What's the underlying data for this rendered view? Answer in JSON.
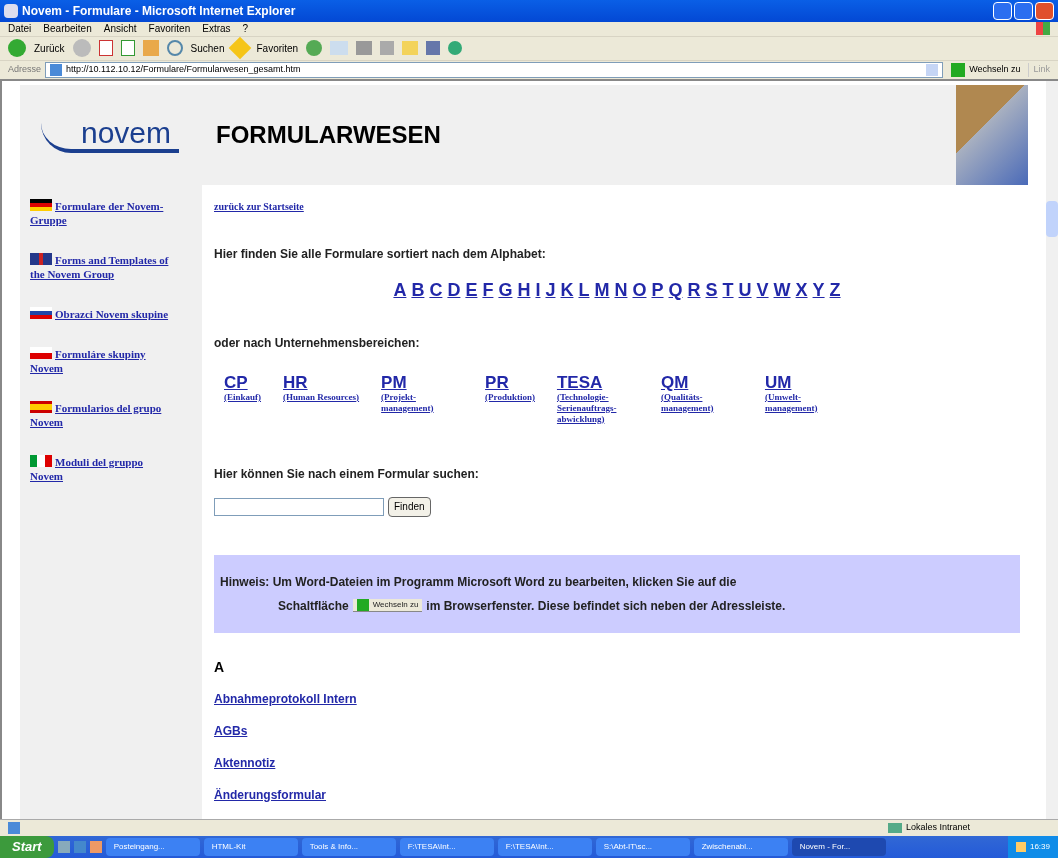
{
  "window": {
    "title": "Novem - Formulare - Microsoft Internet Explorer"
  },
  "menu": [
    "Datei",
    "Bearbeiten",
    "Ansicht",
    "Favoriten",
    "Extras",
    "?"
  ],
  "toolbar": {
    "back": "Zurück",
    "search": "Suchen",
    "favorites": "Favoriten"
  },
  "address": {
    "label": "Adresse",
    "url": "http://10.112.10.12/Formulare/Formularwesen_gesamt.htm",
    "go": "Wechseln zu",
    "links": "Link"
  },
  "page": {
    "logo": "novem",
    "heading": "FORMULARWESEN",
    "sidebar": [
      {
        "kind": "de",
        "label": "Formulare der Novem-Gruppe"
      },
      {
        "kind": "gb",
        "label": "Forms and Templates of the Novem Group"
      },
      {
        "kind": "si",
        "label": "Obrazci Novem skupine"
      },
      {
        "kind": "cz",
        "label": "Formuláre skupiny Novem"
      },
      {
        "kind": "es",
        "label": "Formularios del grupo Novem"
      },
      {
        "kind": "it",
        "label": "Moduli del gruppo Novem"
      }
    ],
    "back_link": "zurück zur Startseite",
    "alphabet_intro": "Hier finden Sie alle Formulare sortiert nach dem Alphabet:",
    "letters": [
      "A",
      "B",
      "C",
      "D",
      "E",
      "F",
      "G",
      "H",
      "I",
      "J",
      "K",
      "L",
      "M",
      "N",
      "O",
      "P",
      "Q",
      "R",
      "S",
      "T",
      "U",
      "V",
      "W",
      "X",
      "Y",
      "Z"
    ],
    "departments_intro": "oder nach Unternehmensbereichen:",
    "departments": [
      {
        "code": "CP",
        "desc": "(Einkauf)"
      },
      {
        "code": "HR",
        "desc": "(Human Resources)"
      },
      {
        "code": "PM",
        "desc": "(Projekt-management)"
      },
      {
        "code": "PR",
        "desc": "(Produktion)"
      },
      {
        "code": "TESA",
        "desc": "(Technologie-Serienauftrags-abwicklung)"
      },
      {
        "code": "QM",
        "desc": "(Qualitäts-management)"
      },
      {
        "code": "UM",
        "desc": "(Umwelt-management)"
      }
    ],
    "search_intro": "Hier können Sie nach einem Formular suchen:",
    "search_button": "Finden",
    "hint": {
      "line1": "Hinweis: Um Word-Dateien im Programm Microsoft Word zu bearbeiten, klicken Sie auf die",
      "before": "Schaltfläche",
      "button": "Wechseln zu",
      "after": "im Browserfenster. Diese befindet sich neben der Adressleiste."
    },
    "section": "A",
    "forms": [
      "Abnahmeprotokoll Intern",
      "AGBs",
      "Aktennotiz",
      "Änderungsformular"
    ]
  },
  "status_bar": {
    "zone": "Lokales Intranet"
  },
  "taskbar": {
    "start": "Start",
    "tasks": [
      {
        "label": "Posteingang...",
        "selected": false
      },
      {
        "label": "HTML-Kit",
        "selected": false
      },
      {
        "label": "Tools & Info...",
        "selected": false
      },
      {
        "label": "F:\\TESA\\Int...",
        "selected": false
      },
      {
        "label": "F:\\TESA\\Int...",
        "selected": false
      },
      {
        "label": "S:\\Abt-IT\\sc...",
        "selected": false
      },
      {
        "label": "Zwischenabl...",
        "selected": false
      },
      {
        "label": "Novem - For...",
        "selected": true
      }
    ],
    "clock": "16:39"
  }
}
